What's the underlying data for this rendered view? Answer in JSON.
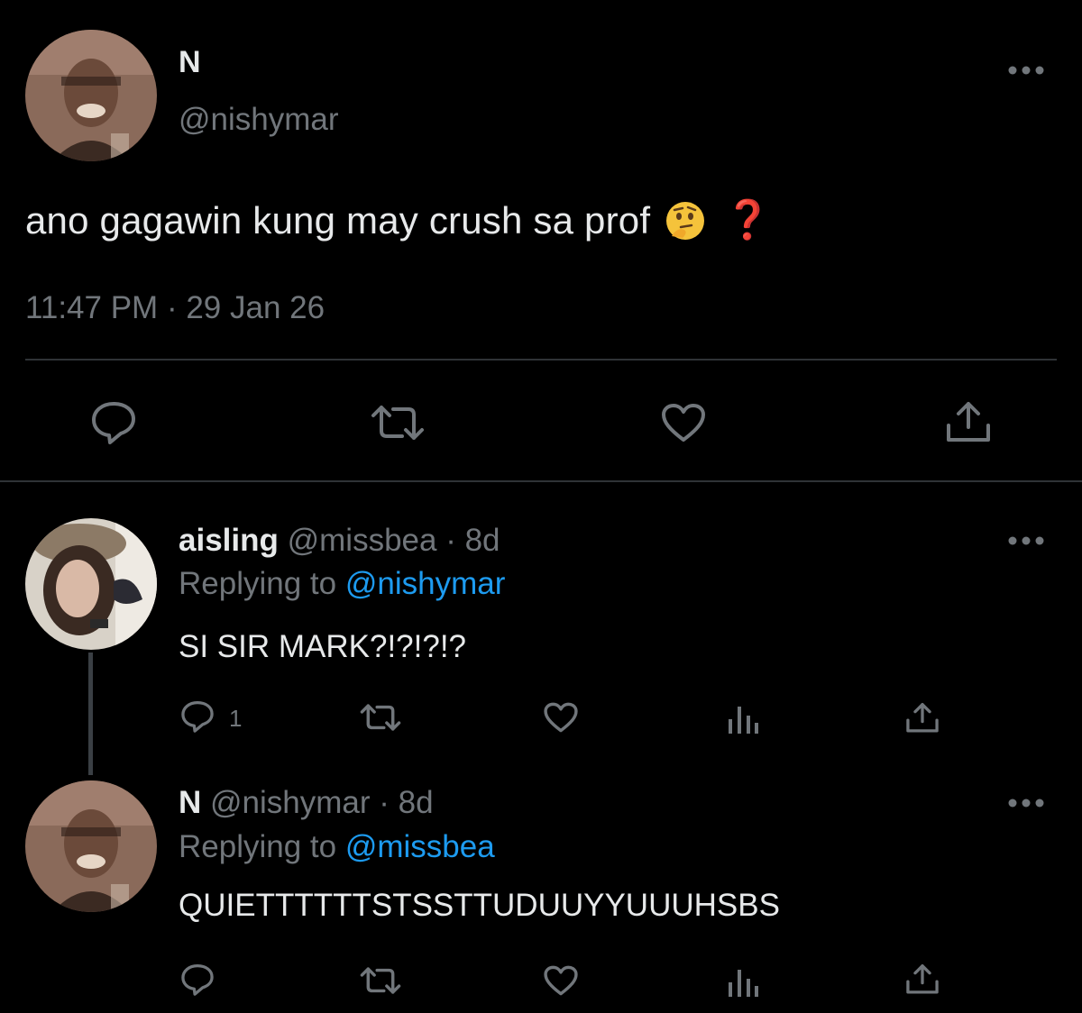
{
  "main_tweet": {
    "author_name": "N",
    "author_handle": "@nishymar",
    "text": "ano gagawin kung may crush sa prof",
    "emoji": "thinking-face-emoji",
    "question_mark": "❓",
    "time": "11:47 PM",
    "separator": "·",
    "date": "29 Jan 26"
  },
  "replies": [
    {
      "author_name": "aisling",
      "author_handle": "@missbea",
      "dot": "·",
      "age": "8d",
      "replying_prefix": "Replying to",
      "replying_handle": "@nishymar",
      "text": "SI SIR MARK?!?!?!?",
      "reply_count": "1"
    },
    {
      "author_name": "N",
      "author_handle": "@nishymar",
      "dot": "·",
      "age": "8d",
      "replying_prefix": "Replying to",
      "replying_handle": "@missbea",
      "text": "QUIETTTTTTSTSSTTUDUUYYUUUHSBS"
    }
  ],
  "colors": {
    "background": "#000000",
    "text": "#e7e9ea",
    "muted": "#71767b",
    "link": "#1d9bf0",
    "divider": "#2f3336",
    "question_mark": "#e0221c"
  },
  "icons": [
    "more-icon",
    "reply-icon",
    "retweet-icon",
    "like-icon",
    "share-icon",
    "analytics-icon"
  ]
}
